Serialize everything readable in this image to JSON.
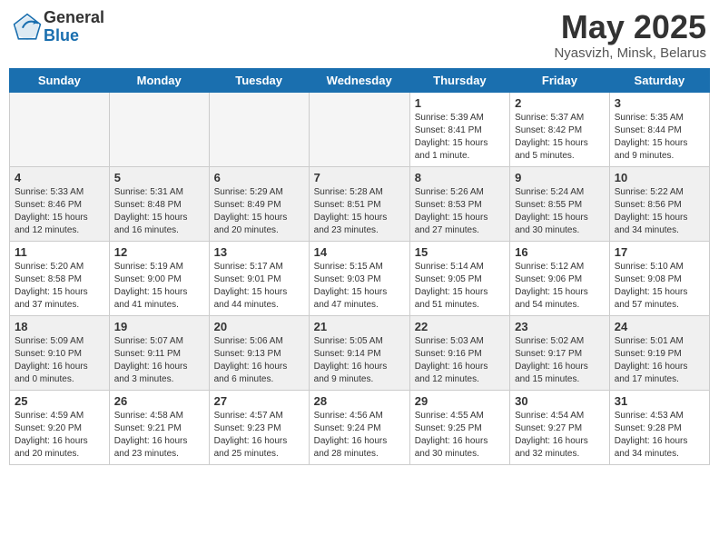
{
  "header": {
    "logo_general": "General",
    "logo_blue": "Blue",
    "month_year": "May 2025",
    "location": "Nyasvizh, Minsk, Belarus"
  },
  "days_of_week": [
    "Sunday",
    "Monday",
    "Tuesday",
    "Wednesday",
    "Thursday",
    "Friday",
    "Saturday"
  ],
  "weeks": [
    [
      {
        "day": "",
        "empty": true
      },
      {
        "day": "",
        "empty": true
      },
      {
        "day": "",
        "empty": true
      },
      {
        "day": "",
        "empty": true
      },
      {
        "day": "1",
        "lines": [
          "Sunrise: 5:39 AM",
          "Sunset: 8:41 PM",
          "Daylight: 15 hours",
          "and 1 minute."
        ]
      },
      {
        "day": "2",
        "lines": [
          "Sunrise: 5:37 AM",
          "Sunset: 8:42 PM",
          "Daylight: 15 hours",
          "and 5 minutes."
        ]
      },
      {
        "day": "3",
        "lines": [
          "Sunrise: 5:35 AM",
          "Sunset: 8:44 PM",
          "Daylight: 15 hours",
          "and 9 minutes."
        ]
      }
    ],
    [
      {
        "day": "4",
        "shaded": true,
        "lines": [
          "Sunrise: 5:33 AM",
          "Sunset: 8:46 PM",
          "Daylight: 15 hours",
          "and 12 minutes."
        ]
      },
      {
        "day": "5",
        "shaded": true,
        "lines": [
          "Sunrise: 5:31 AM",
          "Sunset: 8:48 PM",
          "Daylight: 15 hours",
          "and 16 minutes."
        ]
      },
      {
        "day": "6",
        "shaded": true,
        "lines": [
          "Sunrise: 5:29 AM",
          "Sunset: 8:49 PM",
          "Daylight: 15 hours",
          "and 20 minutes."
        ]
      },
      {
        "day": "7",
        "shaded": true,
        "lines": [
          "Sunrise: 5:28 AM",
          "Sunset: 8:51 PM",
          "Daylight: 15 hours",
          "and 23 minutes."
        ]
      },
      {
        "day": "8",
        "shaded": true,
        "lines": [
          "Sunrise: 5:26 AM",
          "Sunset: 8:53 PM",
          "Daylight: 15 hours",
          "and 27 minutes."
        ]
      },
      {
        "day": "9",
        "shaded": true,
        "lines": [
          "Sunrise: 5:24 AM",
          "Sunset: 8:55 PM",
          "Daylight: 15 hours",
          "and 30 minutes."
        ]
      },
      {
        "day": "10",
        "shaded": true,
        "lines": [
          "Sunrise: 5:22 AM",
          "Sunset: 8:56 PM",
          "Daylight: 15 hours",
          "and 34 minutes."
        ]
      }
    ],
    [
      {
        "day": "11",
        "lines": [
          "Sunrise: 5:20 AM",
          "Sunset: 8:58 PM",
          "Daylight: 15 hours",
          "and 37 minutes."
        ]
      },
      {
        "day": "12",
        "lines": [
          "Sunrise: 5:19 AM",
          "Sunset: 9:00 PM",
          "Daylight: 15 hours",
          "and 41 minutes."
        ]
      },
      {
        "day": "13",
        "lines": [
          "Sunrise: 5:17 AM",
          "Sunset: 9:01 PM",
          "Daylight: 15 hours",
          "and 44 minutes."
        ]
      },
      {
        "day": "14",
        "lines": [
          "Sunrise: 5:15 AM",
          "Sunset: 9:03 PM",
          "Daylight: 15 hours",
          "and 47 minutes."
        ]
      },
      {
        "day": "15",
        "lines": [
          "Sunrise: 5:14 AM",
          "Sunset: 9:05 PM",
          "Daylight: 15 hours",
          "and 51 minutes."
        ]
      },
      {
        "day": "16",
        "lines": [
          "Sunrise: 5:12 AM",
          "Sunset: 9:06 PM",
          "Daylight: 15 hours",
          "and 54 minutes."
        ]
      },
      {
        "day": "17",
        "lines": [
          "Sunrise: 5:10 AM",
          "Sunset: 9:08 PM",
          "Daylight: 15 hours",
          "and 57 minutes."
        ]
      }
    ],
    [
      {
        "day": "18",
        "shaded": true,
        "lines": [
          "Sunrise: 5:09 AM",
          "Sunset: 9:10 PM",
          "Daylight: 16 hours",
          "and 0 minutes."
        ]
      },
      {
        "day": "19",
        "shaded": true,
        "lines": [
          "Sunrise: 5:07 AM",
          "Sunset: 9:11 PM",
          "Daylight: 16 hours",
          "and 3 minutes."
        ]
      },
      {
        "day": "20",
        "shaded": true,
        "lines": [
          "Sunrise: 5:06 AM",
          "Sunset: 9:13 PM",
          "Daylight: 16 hours",
          "and 6 minutes."
        ]
      },
      {
        "day": "21",
        "shaded": true,
        "lines": [
          "Sunrise: 5:05 AM",
          "Sunset: 9:14 PM",
          "Daylight: 16 hours",
          "and 9 minutes."
        ]
      },
      {
        "day": "22",
        "shaded": true,
        "lines": [
          "Sunrise: 5:03 AM",
          "Sunset: 9:16 PM",
          "Daylight: 16 hours",
          "and 12 minutes."
        ]
      },
      {
        "day": "23",
        "shaded": true,
        "lines": [
          "Sunrise: 5:02 AM",
          "Sunset: 9:17 PM",
          "Daylight: 16 hours",
          "and 15 minutes."
        ]
      },
      {
        "day": "24",
        "shaded": true,
        "lines": [
          "Sunrise: 5:01 AM",
          "Sunset: 9:19 PM",
          "Daylight: 16 hours",
          "and 17 minutes."
        ]
      }
    ],
    [
      {
        "day": "25",
        "lines": [
          "Sunrise: 4:59 AM",
          "Sunset: 9:20 PM",
          "Daylight: 16 hours",
          "and 20 minutes."
        ]
      },
      {
        "day": "26",
        "lines": [
          "Sunrise: 4:58 AM",
          "Sunset: 9:21 PM",
          "Daylight: 16 hours",
          "and 23 minutes."
        ]
      },
      {
        "day": "27",
        "lines": [
          "Sunrise: 4:57 AM",
          "Sunset: 9:23 PM",
          "Daylight: 16 hours",
          "and 25 minutes."
        ]
      },
      {
        "day": "28",
        "lines": [
          "Sunrise: 4:56 AM",
          "Sunset: 9:24 PM",
          "Daylight: 16 hours",
          "and 28 minutes."
        ]
      },
      {
        "day": "29",
        "lines": [
          "Sunrise: 4:55 AM",
          "Sunset: 9:25 PM",
          "Daylight: 16 hours",
          "and 30 minutes."
        ]
      },
      {
        "day": "30",
        "lines": [
          "Sunrise: 4:54 AM",
          "Sunset: 9:27 PM",
          "Daylight: 16 hours",
          "and 32 minutes."
        ]
      },
      {
        "day": "31",
        "lines": [
          "Sunrise: 4:53 AM",
          "Sunset: 9:28 PM",
          "Daylight: 16 hours",
          "and 34 minutes."
        ]
      }
    ]
  ]
}
